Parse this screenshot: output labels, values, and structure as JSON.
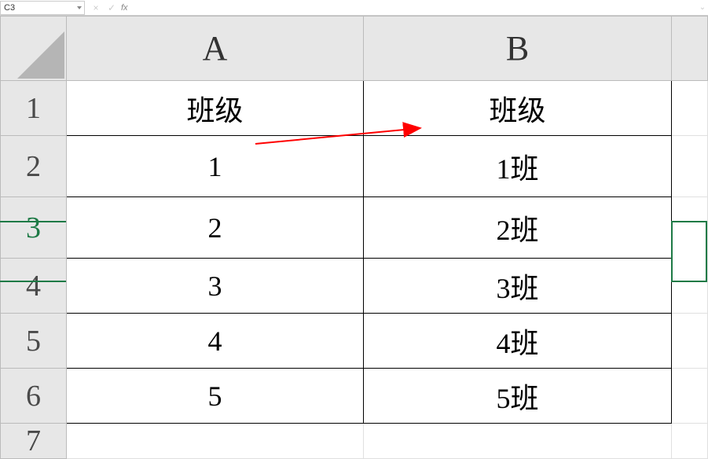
{
  "formula_bar": {
    "cell_reference": "C3",
    "formula": "",
    "fx_label": "fx"
  },
  "columns": {
    "a": "A",
    "b": "B"
  },
  "rows": {
    "r1": "1",
    "r2": "2",
    "r3": "3",
    "r4": "4",
    "r5": "5",
    "r6": "6",
    "r7": "7"
  },
  "cells": {
    "a1": "班级",
    "b1": "班级",
    "a2": "1",
    "b2": "1班",
    "a3": "2",
    "b3": "2班",
    "a4": "3",
    "b4": "3班",
    "a5": "4",
    "b5": "4班",
    "a6": "5",
    "b6": "5班"
  },
  "chart_data": {
    "type": "table",
    "columns": [
      "班级",
      "班级"
    ],
    "rows": [
      [
        "1",
        "1班"
      ],
      [
        "2",
        "2班"
      ],
      [
        "3",
        "3班"
      ],
      [
        "4",
        "4班"
      ],
      [
        "5",
        "5班"
      ]
    ]
  }
}
